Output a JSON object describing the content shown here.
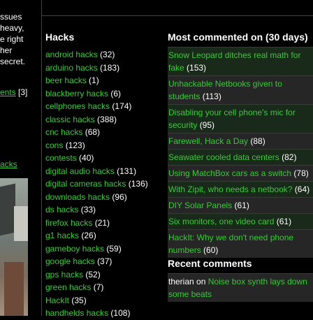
{
  "left_sidebar": {
    "lines": [
      "ssues",
      "heavy,",
      "e right",
      "her",
      "secret."
    ],
    "link_text": "ents",
    "link_count": "[3]",
    "link2_text": "acks"
  },
  "hacks": {
    "title": "Hacks",
    "items": [
      {
        "label": "android hacks",
        "count": "(32)"
      },
      {
        "label": "arduino hacks",
        "count": "(183)"
      },
      {
        "label": "beer hacks",
        "count": "(1)"
      },
      {
        "label": "blackberry hacks",
        "count": "(6)"
      },
      {
        "label": "cellphones hacks",
        "count": "(174)"
      },
      {
        "label": "classic hacks",
        "count": "(388)"
      },
      {
        "label": "cnc hacks",
        "count": "(68)"
      },
      {
        "label": "cons",
        "count": "(123)"
      },
      {
        "label": "contests",
        "count": "(40)"
      },
      {
        "label": "digital audio hacks",
        "count": "(131)"
      },
      {
        "label": "digital cameras hacks",
        "count": "(136)"
      },
      {
        "label": "downloads hacks",
        "count": "(96)"
      },
      {
        "label": "ds hacks",
        "count": "(33)"
      },
      {
        "label": "firefox hacks",
        "count": "(21)"
      },
      {
        "label": "g1 hacks",
        "count": "(26)"
      },
      {
        "label": "gameboy hacks",
        "count": "(59)"
      },
      {
        "label": "google hacks",
        "count": "(37)"
      },
      {
        "label": "gps hacks",
        "count": "(52)"
      },
      {
        "label": "green hacks",
        "count": "(7)"
      },
      {
        "label": "HackIt",
        "count": "(35)"
      },
      {
        "label": "handhelds hacks",
        "count": "(108)"
      }
    ]
  },
  "most_commented": {
    "title": "Most commented on (30 days)",
    "items": [
      {
        "label": "Snow Leopard ditches real math for fake",
        "count": "(153)"
      },
      {
        "label": "Unhackable Netbooks given to students",
        "count": "(113)"
      },
      {
        "label": "Disabling your cell phone's mic for security",
        "count": "(95)"
      },
      {
        "label": "Farewell, Hack a Day",
        "count": "(88)"
      },
      {
        "label": "Seawater cooled data centers",
        "count": "(82)"
      },
      {
        "label": "Using MatchBox cars as a switch",
        "count": "(78)"
      },
      {
        "label": "With Zipit, who needs a netbook?",
        "count": "(64)"
      },
      {
        "label": "DIY Solar Panels",
        "count": "(61)"
      },
      {
        "label": "Six monitors, one video card",
        "count": "(61)"
      },
      {
        "label": "HackIt: Why we don't need phone numbers",
        "count": "(60)"
      }
    ]
  },
  "recent_comments": {
    "title": "Recent comments",
    "items": [
      {
        "author": "therian",
        "on": "on",
        "post": "Noise box synth lays down some beats"
      }
    ]
  },
  "colors": {
    "link": "#33cc33",
    "background": "#000000"
  }
}
